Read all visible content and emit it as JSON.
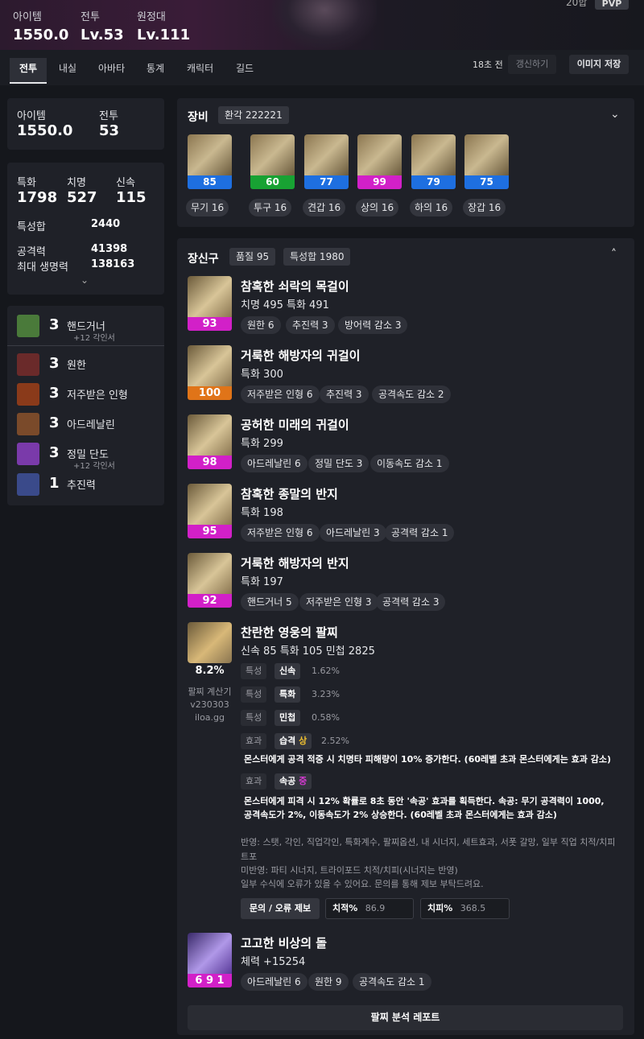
{
  "header": {
    "stats": [
      {
        "label": "아이템",
        "value": "1550.0"
      },
      {
        "label": "전투",
        "value": "Lv.53"
      },
      {
        "label": "원정대",
        "value": "Lv.111"
      }
    ],
    "pvp_count": "20합",
    "pvp_label": "PVP"
  },
  "tabs": [
    "전투",
    "내실",
    "아바타",
    "통계",
    "캐릭터",
    "길드"
  ],
  "toolbar": {
    "updated": "18초 전",
    "refresh": "갱신하기",
    "save_image": "이미지 저장"
  },
  "summary": {
    "item_label": "아이템",
    "item_value": "1550.0",
    "combat_label": "전투",
    "combat_value": "53"
  },
  "stats_card": {
    "crit_label": "특화",
    "crit_value": "1798",
    "spec_label": "치명",
    "spec_value": "527",
    "swift_label": "신속",
    "swift_value": "115",
    "sum_label": "특성합",
    "sum_value": "2440",
    "atk_label": "공격력",
    "atk_value": "41398",
    "hp_label": "최대 생명력",
    "hp_value": "138163"
  },
  "engravings": [
    {
      "level": "3",
      "name": "핸드거너",
      "sub": "+12 각인서",
      "icon_color": "#4a7a3a"
    },
    {
      "level": "3",
      "name": "원한",
      "sub": "",
      "icon_color": "#6a2a2a"
    },
    {
      "level": "3",
      "name": "저주받은 인형",
      "sub": "",
      "icon_color": "#8a3a1a"
    },
    {
      "level": "3",
      "name": "아드레날린",
      "sub": "",
      "icon_color": "#7a4a2a"
    },
    {
      "level": "3",
      "name": "정밀 단도",
      "sub": "+12 각인서",
      "icon_color": "#7a3aaa"
    },
    {
      "level": "1",
      "name": "추진력",
      "sub": "",
      "icon_color": "#3a4a8a"
    }
  ],
  "equipment": {
    "title": "장비",
    "badge": "환각 222221",
    "items": [
      {
        "quality": "85",
        "name": "무기 16",
        "color": "#1e6fe0"
      },
      {
        "quality": "60",
        "name": "투구 16",
        "color": "#18a233"
      },
      {
        "quality": "77",
        "name": "견갑 16",
        "color": "#1e6fe0"
      },
      {
        "quality": "99",
        "name": "상의 16",
        "color": "#d220c8"
      },
      {
        "quality": "79",
        "name": "하의 16",
        "color": "#1e6fe0"
      },
      {
        "quality": "75",
        "name": "장갑 16",
        "color": "#1e6fe0"
      }
    ]
  },
  "accessories": {
    "title": "장신구",
    "quality_badge": "품질 95",
    "sum_badge": "특성합 1980",
    "items": [
      {
        "quality": "93",
        "color": "#d220c8",
        "name": "참혹한 쇠락의 목걸이",
        "stats": "치명 495  특화 491",
        "tags": [
          "원한 6",
          "추진력 3",
          "방어력 감소 3"
        ]
      },
      {
        "quality": "100",
        "color": "#e07418",
        "name": "거룩한 해방자의 귀걸이",
        "stats": "특화 300",
        "tags": [
          "저주받은 인형 6",
          "추진력 3",
          "공격속도 감소 2"
        ]
      },
      {
        "quality": "98",
        "color": "#d220c8",
        "name": "공허한 미래의 귀걸이",
        "stats": "특화 299",
        "tags": [
          "아드레날린 6",
          "정밀 단도 3",
          "이동속도 감소 1"
        ]
      },
      {
        "quality": "95",
        "color": "#d220c8",
        "name": "참혹한 종말의 반지",
        "stats": "특화 198",
        "tags": [
          "저주받은 인형 6",
          "아드레날린 3",
          "공격력 감소 1"
        ]
      },
      {
        "quality": "92",
        "color": "#d220c8",
        "name": "거룩한 해방자의 반지",
        "stats": "특화 197",
        "tags": [
          "핸드거너 5",
          "저주받은 인형 3",
          "공격력 감소 3"
        ]
      }
    ]
  },
  "bracelet": {
    "name": "찬란한 영웅의 팔찌",
    "stats": "신속 85  특화 105  민첩 2825",
    "percent": "8.2%",
    "calc_lines": [
      "팔찌 계산기",
      "v230303",
      "iloa.gg"
    ],
    "rows": [
      {
        "kind": "특성",
        "name": "신속",
        "grade": "",
        "value": "1.62%"
      },
      {
        "kind": "특성",
        "name": "특화",
        "grade": "",
        "value": "3.23%"
      },
      {
        "kind": "특성",
        "name": "민첩",
        "grade": "",
        "value": "0.58%"
      },
      {
        "kind": "효과",
        "name": "습격",
        "grade": "상",
        "value": "2.52%"
      }
    ],
    "desc1": "몬스터에게 공격 적중 시 치명타 피해량이 10% 증가한다. (60레벨 초과 몬스터에게는 효과 감소)",
    "row5": {
      "kind": "효과",
      "name": "속공",
      "grade": "중"
    },
    "desc2a": "몬스터에게 피격 시 12% 확률로 8초 동안 '속공' 효과를 획득한다. 속공: 무기 공격력이 1000,",
    "desc2b": "공격속도가 2%, 이동속도가 2% 상승한다. (60레벨 초과 몬스터에게는 효과 감소)",
    "note1": "반영: 스탯, 각인, 직업각인, 특화계수, 팔찌옵션, 내 시너지, 세트효과, 서폿 갈망, 일부 직업 치적/치피",
    "note1b": "트포",
    "note2": "미반영: 파티 시너지, 트라이포드 치적/치피(시너지는 반영)",
    "note3": "일부 수식에 오류가 있을 수 있어요. 문의를 통해 제보 부탁드려요.",
    "report_btn": "문의 / 오류 제보",
    "crit_label": "치적%",
    "crit_value": "86.9",
    "critdmg_label": "치피%",
    "critdmg_value": "368.5"
  },
  "stone": {
    "quality": "6 9 1",
    "name": "고고한 비상의 돌",
    "stats": "체력 +15254",
    "tags": [
      "아드레날린 6",
      "원한 9",
      "공격속도 감소 1"
    ]
  },
  "bottom_button": "팔찌 분석 레포트"
}
